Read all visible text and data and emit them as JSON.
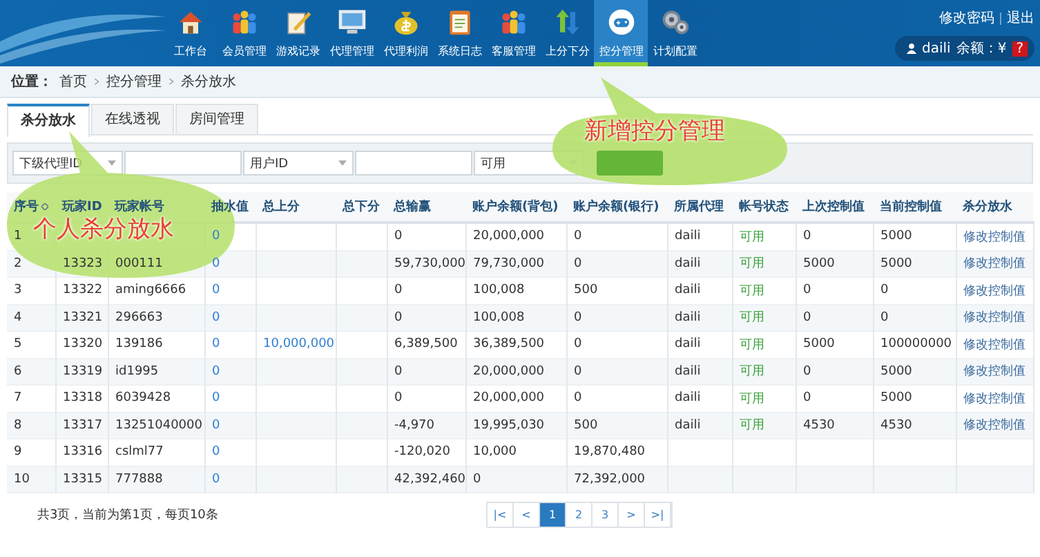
{
  "nav": {
    "items": [
      {
        "label": "工作台",
        "selected": false
      },
      {
        "label": "会员管理",
        "selected": false
      },
      {
        "label": "游戏记录",
        "selected": false
      },
      {
        "label": "代理管理",
        "selected": false
      },
      {
        "label": "代理利润",
        "selected": false
      },
      {
        "label": "系统日志",
        "selected": false
      },
      {
        "label": "客服管理",
        "selected": false
      },
      {
        "label": "上分下分",
        "selected": false
      },
      {
        "label": "控分管理",
        "selected": true
      },
      {
        "label": "计划配置",
        "selected": false
      }
    ],
    "links": [
      "修改密码",
      "退出"
    ],
    "user": {
      "name": "daili",
      "balance_label": "余额：¥",
      "balance": "?"
    }
  },
  "breadcrumb": {
    "label": "位置：",
    "items": [
      "首页",
      "控分管理",
      "杀分放水"
    ]
  },
  "tabs": [
    {
      "label": "杀分放水",
      "selected": true
    },
    {
      "label": "在线透视",
      "selected": false
    },
    {
      "label": "房间管理",
      "selected": false
    }
  ],
  "filters": [
    {
      "kind": "select",
      "value": "下级代理ID"
    },
    {
      "kind": "input"
    },
    {
      "kind": "select",
      "value": "用户ID"
    },
    {
      "kind": "input"
    },
    {
      "kind": "select",
      "value": "可用"
    },
    {
      "kind": "button"
    }
  ],
  "table": {
    "columns": [
      {
        "label": "序号",
        "kind": "text",
        "sortable": true
      },
      {
        "label": "玩家ID",
        "kind": "text",
        "sortable": false
      },
      {
        "label": "玩家帐号",
        "kind": "text",
        "sortable": false
      },
      {
        "label": "抽水值",
        "kind": "value",
        "sortable": false
      },
      {
        "label": "总上分",
        "kind": "value",
        "sortable": false
      },
      {
        "label": "总下分",
        "kind": "text",
        "sortable": false
      },
      {
        "label": "总输赢",
        "kind": "text",
        "sortable": false
      },
      {
        "label": "账户余额(背包)",
        "kind": "text",
        "sortable": false
      },
      {
        "label": "账户余额(银行)",
        "kind": "text",
        "sortable": false
      },
      {
        "label": "所属代理",
        "kind": "text",
        "sortable": false
      },
      {
        "label": "帐号状态",
        "kind": "status",
        "sortable": false
      },
      {
        "label": "上次控制值",
        "kind": "text",
        "sortable": false
      },
      {
        "label": "当前控制值",
        "kind": "text",
        "sortable": false
      },
      {
        "label": "杀分放水",
        "kind": "action",
        "sortable": false
      }
    ],
    "rows": [
      [
        "1",
        null,
        null,
        "0",
        null,
        null,
        "0",
        "20,000,000",
        "0",
        "daili",
        "可用",
        "0",
        "5000",
        "修改控制值"
      ],
      [
        "2",
        "13323",
        "000111",
        "0",
        null,
        null,
        "59,730,000",
        "79,730,000",
        "0",
        "daili",
        "可用",
        "5000",
        "5000",
        "修改控制值"
      ],
      [
        "3",
        "13322",
        "aming6666",
        "0",
        null,
        null,
        "0",
        "100,008",
        "500",
        "daili",
        "可用",
        "0",
        "0",
        "修改控制值"
      ],
      [
        "4",
        "13321",
        "296663",
        "0",
        null,
        null,
        "0",
        "100,008",
        "0",
        "daili",
        "可用",
        "0",
        "0",
        "修改控制值"
      ],
      [
        "5",
        "13320",
        "139186",
        "0",
        "10,000,000",
        null,
        "6,389,500",
        "36,389,500",
        "0",
        "daili",
        "可用",
        "5000",
        "100000000",
        "修改控制值"
      ],
      [
        "6",
        "13319",
        "id1995",
        "0",
        null,
        null,
        "0",
        "20,000,000",
        "0",
        "daili",
        "可用",
        "0",
        "5000",
        "修改控制值"
      ],
      [
        "7",
        "13318",
        "6039428",
        "0",
        null,
        null,
        "0",
        "20,000,000",
        "0",
        "daili",
        "可用",
        "0",
        "5000",
        "修改控制值"
      ],
      [
        "8",
        "13317",
        "13251040000",
        "0",
        null,
        null,
        "-4,970",
        "19,995,030",
        "500",
        "daili",
        "可用",
        "4530",
        "4530",
        "修改控制值"
      ],
      [
        "9",
        "13316",
        "cslml77",
        "0",
        null,
        null,
        "-120,020",
        "10,000",
        "19,870,480",
        null,
        null,
        null,
        null,
        null
      ],
      [
        "10",
        "13315",
        "777888",
        "0",
        null,
        null,
        "42,392,460",
        "0",
        "72,392,000",
        null,
        null,
        null,
        null,
        null
      ]
    ]
  },
  "pagination": {
    "summary": "共3页，当前为第1页，每页10条",
    "buttons": [
      {
        "label": "|<",
        "selected": false
      },
      {
        "label": "<",
        "selected": false
      },
      {
        "label": "1",
        "selected": true
      },
      {
        "label": "2",
        "selected": false
      },
      {
        "label": "3",
        "selected": false
      },
      {
        "label": ">",
        "selected": false
      },
      {
        "label": ">|",
        "selected": false
      }
    ]
  },
  "callouts": [
    {
      "text": "个人杀分放水"
    },
    {
      "text": "新增控分管理"
    }
  ]
}
